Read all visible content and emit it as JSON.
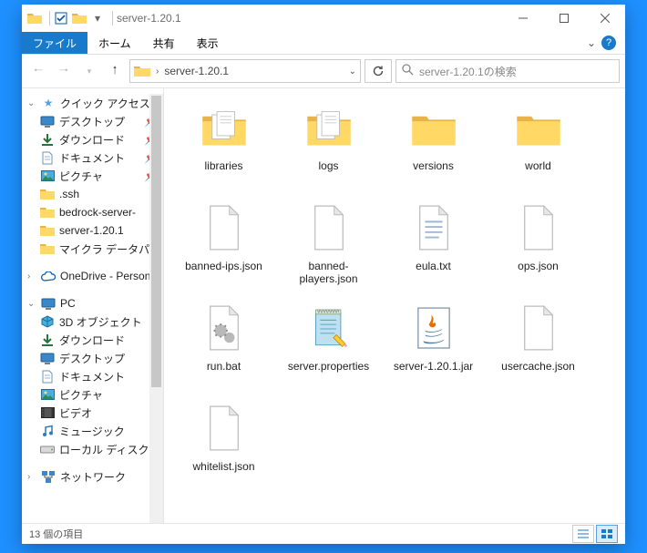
{
  "titlebar": {
    "title": "server-1.20.1"
  },
  "ribbon": {
    "tabs": [
      "ファイル",
      "ホーム",
      "共有",
      "表示"
    ]
  },
  "nav": {
    "path": "server-1.20.1",
    "search_placeholder": "server-1.20.1の検索"
  },
  "sidebar": {
    "quick_access": "クイック アクセス",
    "items_pinned": [
      {
        "label": "デスクトップ",
        "icon": "desktop"
      },
      {
        "label": "ダウンロード",
        "icon": "download"
      },
      {
        "label": "ドキュメント",
        "icon": "document"
      },
      {
        "label": "ピクチャ",
        "icon": "pictures"
      }
    ],
    "items_recent": [
      {
        "label": ".ssh",
        "icon": "folder"
      },
      {
        "label": "bedrock-server-",
        "icon": "folder"
      },
      {
        "label": "server-1.20.1",
        "icon": "folder"
      },
      {
        "label": "マイクラ データパッ",
        "icon": "folder"
      }
    ],
    "onedrive": "OneDrive - Person",
    "pc": "PC",
    "pc_items": [
      {
        "label": "3D オブジェクト",
        "icon": "3d"
      },
      {
        "label": "ダウンロード",
        "icon": "download"
      },
      {
        "label": "デスクトップ",
        "icon": "desktop"
      },
      {
        "label": "ドキュメント",
        "icon": "document"
      },
      {
        "label": "ピクチャ",
        "icon": "pictures"
      },
      {
        "label": "ビデオ",
        "icon": "video"
      },
      {
        "label": "ミュージック",
        "icon": "music"
      },
      {
        "label": "ローカル ディスク (C",
        "icon": "drive"
      }
    ],
    "network": "ネットワーク"
  },
  "files": [
    {
      "name": "libraries",
      "type": "folder-docs"
    },
    {
      "name": "logs",
      "type": "folder-docs"
    },
    {
      "name": "versions",
      "type": "folder"
    },
    {
      "name": "world",
      "type": "folder"
    },
    {
      "name": "banned-ips.json",
      "type": "file"
    },
    {
      "name": "banned-players.json",
      "type": "file"
    },
    {
      "name": "eula.txt",
      "type": "txt"
    },
    {
      "name": "ops.json",
      "type": "file"
    },
    {
      "name": "run.bat",
      "type": "bat"
    },
    {
      "name": "server.properties",
      "type": "prop"
    },
    {
      "name": "server-1.20.1.jar",
      "type": "jar"
    },
    {
      "name": "usercache.json",
      "type": "file"
    },
    {
      "name": "whitelist.json",
      "type": "file"
    }
  ],
  "status": {
    "count": "13 個の項目"
  }
}
